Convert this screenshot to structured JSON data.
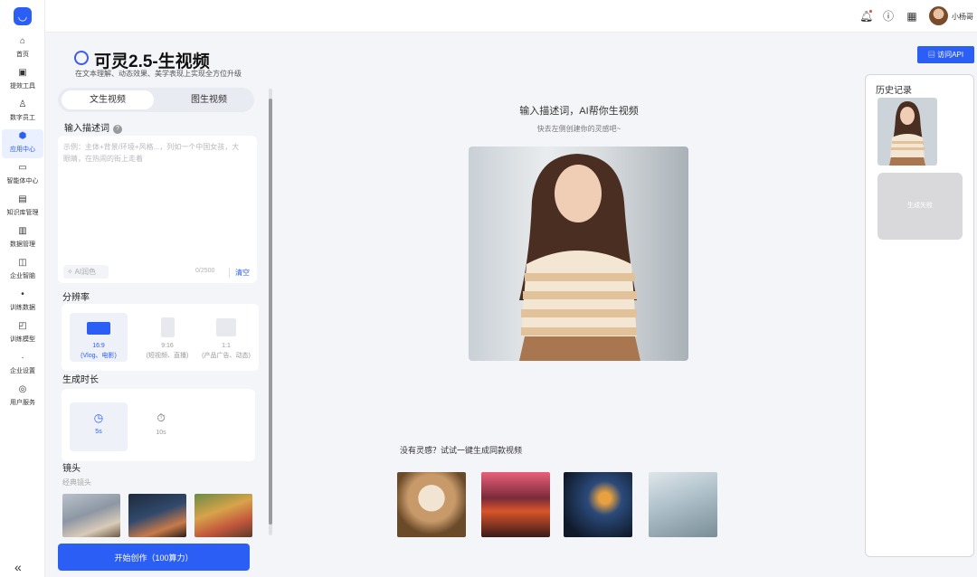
{
  "sidebar": {
    "items": [
      {
        "label": "首页",
        "icon": "home-icon"
      },
      {
        "label": "提效工具",
        "icon": "tool-icon"
      },
      {
        "label": "数字员工",
        "icon": "person-icon"
      },
      {
        "label": "应用中心",
        "icon": "app-icon",
        "active": true
      },
      {
        "label": "智能体中心",
        "icon": "agent-icon"
      },
      {
        "label": "知识库管理",
        "icon": "book-icon"
      },
      {
        "label": "数据管理",
        "icon": "data-icon"
      },
      {
        "label": "企业智脑",
        "icon": "brain-icon"
      },
      {
        "label": "训练数据",
        "icon": "dot-icon"
      },
      {
        "label": "训练模型",
        "icon": "model-icon"
      },
      {
        "label": "企业设置",
        "icon": "dot-icon"
      },
      {
        "label": "用户服务",
        "icon": "service-icon"
      }
    ],
    "collapse": "«"
  },
  "header": {
    "username": "小杨哥"
  },
  "page": {
    "title": "可灵2.5-生视频",
    "subtitle": "在文本理解、动态效果、美学表现上实现全方位升级"
  },
  "panel": {
    "tabs": [
      "文生视频",
      "图生视频"
    ],
    "prompt_label": "输入描述词",
    "prompt_placeholder": "示例：主体+背景/环境+风格...，列如一个中国女孩，大眼睛，在热闹的街上走着",
    "ai_color": "AI润色",
    "counter": "0/2500",
    "clear": "清空",
    "resolution_label": "分辨率",
    "resolutions": [
      {
        "ratio": "16:9",
        "desc": "(Vlog、电影)",
        "selected": true
      },
      {
        "ratio": "9:16",
        "desc": "(短视频、直播)",
        "selected": false
      },
      {
        "ratio": "1:1",
        "desc": "(产品广告、动态)",
        "selected": false
      }
    ],
    "duration_label": "生成时长",
    "durations": [
      {
        "value": "5s",
        "selected": true
      },
      {
        "value": "10s",
        "selected": false
      }
    ],
    "shots_label": "镜头",
    "shots_sub": "经典镜头",
    "start_button": "开始创作（100算力）"
  },
  "center": {
    "title": "输入描述词，AI帮你生视频",
    "subtitle": "快去左侧创建你的灵感吧~",
    "inspire": "没有灵感？试试一键生成同款视频"
  },
  "right": {
    "api_button": "访问API",
    "history_title": "历史记录",
    "fail_text": "生成失败"
  },
  "colors": {
    "accent": "#2b5ef5"
  }
}
